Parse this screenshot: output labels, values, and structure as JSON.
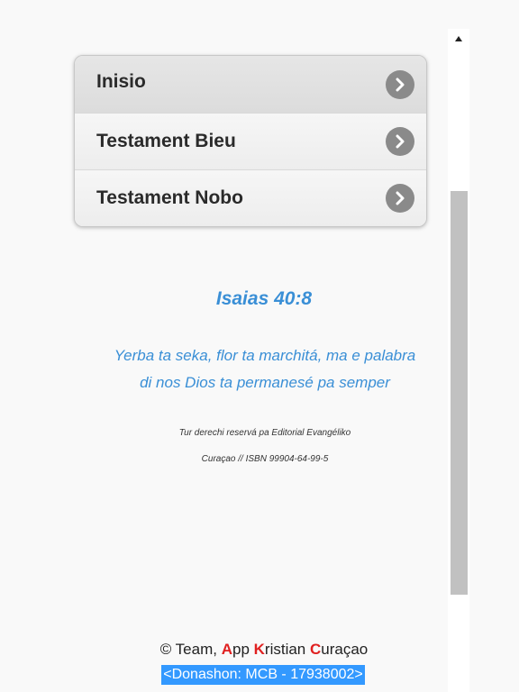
{
  "menu": {
    "items": [
      {
        "label": "Inisio"
      },
      {
        "label": "Testament Bieu"
      },
      {
        "label": "Testament Nobo"
      }
    ]
  },
  "verse": {
    "reference": "Isaias 40:8",
    "line1": "Yerba ta seka, flor ta marchitá, ma e palabra",
    "line2": "di nos Dios ta permanesé pa semper"
  },
  "rights": {
    "line1": "Tur derechi reservá pa Editorial Evangéliko",
    "line2": "Curaçao // ISBN 99904-64-99-5"
  },
  "footer": {
    "prefix": "© Team, ",
    "a_initial": "A",
    "a_rest": "pp ",
    "k_initial": "K",
    "k_rest": "ristian ",
    "c_initial": "C",
    "c_rest": "uraçao",
    "donation": "<Donashon: MCB - 17938002>"
  },
  "icons": {
    "chevron": "chevron-right-icon",
    "scroll_up": "arrow-up-icon"
  },
  "colors": {
    "accent_blue": "#3a8fd6",
    "accent_red": "#e02020",
    "selection_blue": "#3399ff",
    "chevron_gray": "#8a8a8a"
  }
}
